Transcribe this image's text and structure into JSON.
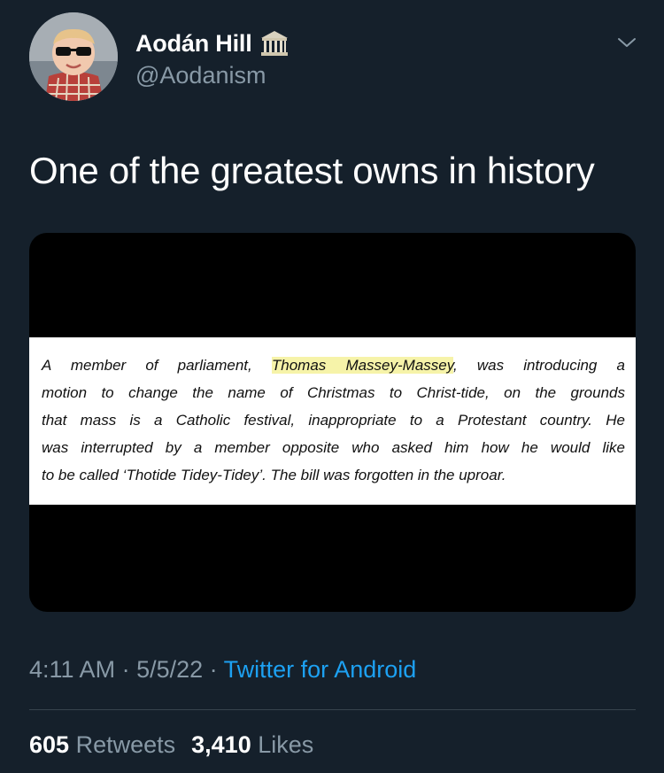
{
  "author": {
    "name": "Aodán Hill",
    "handle": "@Aodanism",
    "name_emoji_icon": "classical-building-icon"
  },
  "tweet": {
    "text": "One of the greatest owns in history"
  },
  "media": {
    "clipping_lines": [
      [
        "A member of parliament, ",
        "Thomas Massey-Massey",
        ", was introducing a"
      ],
      [
        "motion to change the name of Christmas to Christ-tide, on the grounds"
      ],
      [
        "that mass is a Catholic festival, inappropriate to a Protestant country. He"
      ],
      [
        "was interrupted by a member opposite who asked him how he would like"
      ],
      [
        "to be called ‘Thotide Tidey-Tidey’. The bill was forgotten in the uproar."
      ]
    ]
  },
  "meta": {
    "time": "4:11 AM",
    "sep1": " · ",
    "date": "5/5/22",
    "sep2": " · ",
    "source": "Twitter for Android"
  },
  "stats": {
    "retweets_count": "605",
    "retweets_label": "Retweets",
    "likes_count": "3,410",
    "likes_label": "Likes"
  },
  "colors": {
    "background": "#15202b",
    "secondary_text": "#8899a6",
    "link": "#1da1f2",
    "divider": "#38444d",
    "highlight": "#f6f3a9"
  }
}
